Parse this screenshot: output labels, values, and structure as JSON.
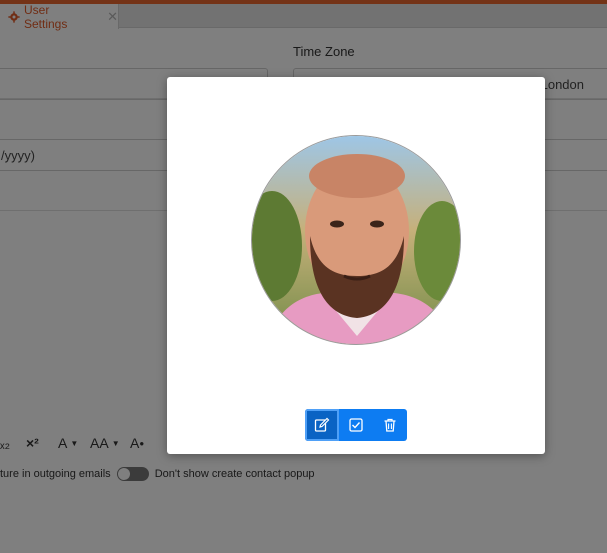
{
  "tab": {
    "label": "User Settings",
    "close": "✕"
  },
  "form": {
    "time_zone_label": "Time Zone",
    "time_zone_value": "London",
    "date_format_value": "/yyyy)"
  },
  "toolbar": {
    "subscript": "ₓ₂",
    "superscript": "×²",
    "font_color": "A",
    "font_size": "AA",
    "clear_format": "A"
  },
  "options": {
    "signature_text": "ture in outgoing emails",
    "contact_popup_text": "Don't show create contact popup"
  },
  "modal": {
    "actions": [
      "edit",
      "confirm",
      "delete"
    ]
  },
  "colors": {
    "accent": "#0d7cf2",
    "brand": "#e8672e",
    "overlay": "rgba(0,0,0,0.5)"
  }
}
